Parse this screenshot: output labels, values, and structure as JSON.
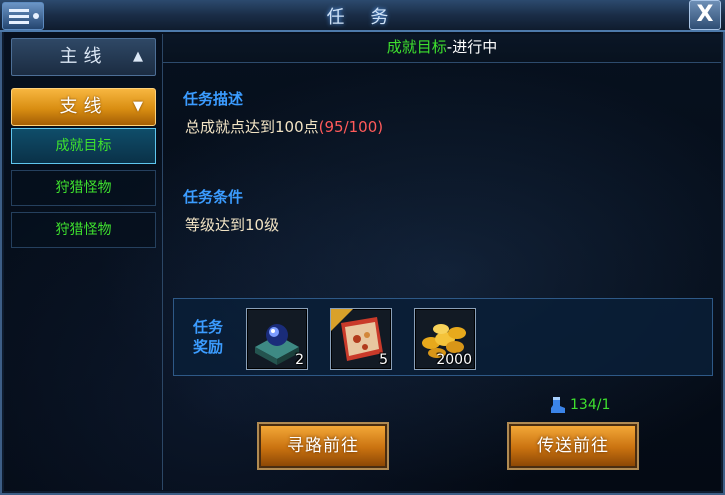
{
  "window": {
    "title": "任 务",
    "close_label": "X"
  },
  "sidebar": {
    "main_tab": "主线",
    "branch_tab": "支线",
    "items": [
      {
        "label": "成就目标",
        "active": true
      },
      {
        "label": "狩猎怪物",
        "active": false
      },
      {
        "label": "狩猎怪物",
        "active": false
      }
    ]
  },
  "quest": {
    "name": "成就目标",
    "status": "-进行中",
    "description_title": "任务描述",
    "description_text": "总成就点达到100点",
    "description_progress": "(95/100)",
    "condition_title": "任务条件",
    "condition_text": "等级达到10级"
  },
  "rewards": {
    "label": "任务\n奖励",
    "items": [
      {
        "icon": "gem-chest-icon",
        "count": "2"
      },
      {
        "icon": "red-package-icon",
        "count": "5"
      },
      {
        "icon": "gold-coins-icon",
        "count": "2000"
      }
    ]
  },
  "energy": {
    "icon": "boot-icon",
    "value": "134/1"
  },
  "buttons": {
    "pathfind": "寻路前往",
    "teleport": "传送前往"
  },
  "colors": {
    "accent_blue": "#3b9cff",
    "quest_green": "#3ee02e",
    "progress_red": "#ff5a5a",
    "button_orange": "#e8901c"
  }
}
